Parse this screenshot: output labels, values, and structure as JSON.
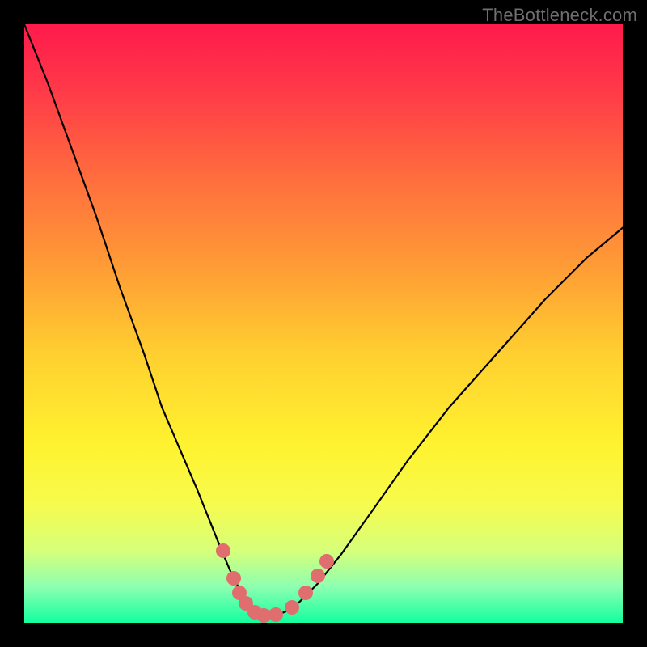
{
  "watermark": {
    "text": "TheBottleneck.com"
  },
  "colors": {
    "marker": "#e06e6e",
    "curve": "#000000",
    "gradient_stops": [
      {
        "offset": 0.0,
        "color": "#ff1a4c"
      },
      {
        "offset": 0.1,
        "color": "#ff3649"
      },
      {
        "offset": 0.25,
        "color": "#ff6b3e"
      },
      {
        "offset": 0.4,
        "color": "#ff9a36"
      },
      {
        "offset": 0.55,
        "color": "#ffcf30"
      },
      {
        "offset": 0.7,
        "color": "#fff22f"
      },
      {
        "offset": 0.8,
        "color": "#f7fb4c"
      },
      {
        "offset": 0.88,
        "color": "#d6ff7a"
      },
      {
        "offset": 0.94,
        "color": "#8dffb1"
      },
      {
        "offset": 1.0,
        "color": "#12ff9f"
      }
    ]
  },
  "chart_data": {
    "type": "line",
    "title": "",
    "xlabel": "",
    "ylabel": "",
    "xlim": [
      0,
      1
    ],
    "ylim": [
      0,
      1
    ],
    "note": "x,y normalized to plot area. Curve is plotted top-down (y=1 top). Minimum near x≈0.39, y≈0.",
    "series": [
      {
        "name": "bottleneck-curve",
        "x": [
          0.0,
          0.04,
          0.08,
          0.12,
          0.16,
          0.2,
          0.23,
          0.26,
          0.29,
          0.31,
          0.33,
          0.345,
          0.36,
          0.375,
          0.39,
          0.405,
          0.42,
          0.44,
          0.46,
          0.49,
          0.53,
          0.58,
          0.64,
          0.71,
          0.79,
          0.87,
          0.94,
          1.0
        ],
        "y": [
          1.0,
          0.9,
          0.79,
          0.68,
          0.56,
          0.45,
          0.36,
          0.29,
          0.22,
          0.17,
          0.12,
          0.085,
          0.055,
          0.03,
          0.015,
          0.01,
          0.012,
          0.02,
          0.035,
          0.065,
          0.115,
          0.185,
          0.27,
          0.36,
          0.45,
          0.54,
          0.61,
          0.66
        ]
      }
    ],
    "markers": {
      "name": "highlight-points",
      "color": "#e06e6e",
      "points": [
        {
          "x": 0.333,
          "y": 0.12
        },
        {
          "x": 0.35,
          "y": 0.075
        },
        {
          "x": 0.36,
          "y": 0.05
        },
        {
          "x": 0.37,
          "y": 0.033
        },
        {
          "x": 0.385,
          "y": 0.018
        },
        {
          "x": 0.4,
          "y": 0.012
        },
        {
          "x": 0.42,
          "y": 0.013
        },
        {
          "x": 0.447,
          "y": 0.026
        },
        {
          "x": 0.47,
          "y": 0.05
        },
        {
          "x": 0.49,
          "y": 0.078
        },
        {
          "x": 0.505,
          "y": 0.103
        }
      ]
    }
  }
}
